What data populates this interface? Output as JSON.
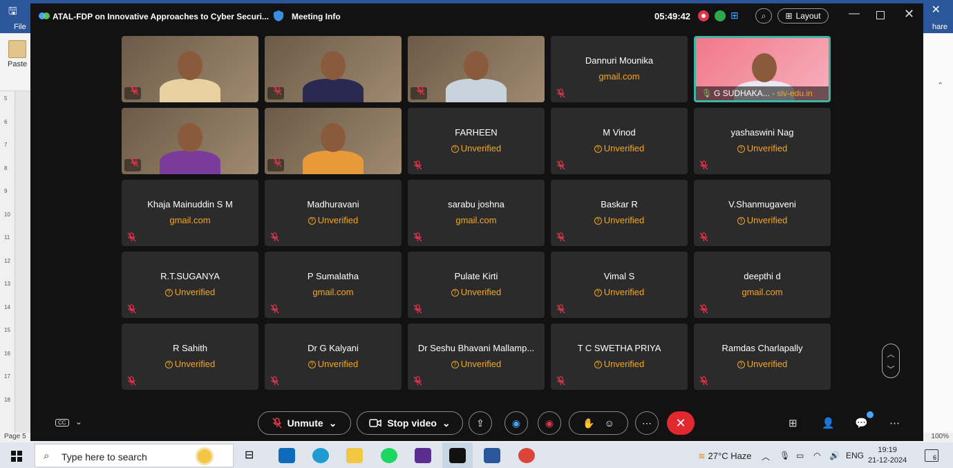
{
  "word": {
    "file_label": "File",
    "share_label": "hare",
    "paste_label": "Paste",
    "page_label": "Page 5",
    "zoom_label": "100%",
    "ruler_numbers": [
      "5",
      "6",
      "7",
      "8",
      "9",
      "10",
      "11",
      "12",
      "13",
      "14",
      "15",
      "16",
      "17",
      "18"
    ]
  },
  "meeting": {
    "title": "ATAL-FDP on Innovative Approaches to Cyber Securi...",
    "info_label": "Meeting Info",
    "timer": "05:49:42",
    "layout_label": "Layout"
  },
  "participants": [
    {
      "video": true,
      "name": "",
      "sub": "",
      "tone": "#caa47a",
      "shirt": "#e8d0a0"
    },
    {
      "video": true,
      "name": "",
      "sub": "",
      "tone": "#6b4a2e",
      "shirt": "#2a2a50"
    },
    {
      "video": true,
      "name": "",
      "sub": "",
      "tone": "#b69a86",
      "shirt": "#c8d4dc"
    },
    {
      "video": false,
      "name": "Dannuri  Mounika",
      "sub": "gmail.com",
      "unverified": false
    },
    {
      "video": true,
      "active": true,
      "name": "G SUDHAKA...",
      "domain": "slv-edu.in",
      "tone": "#f08a9a",
      "shirt": "#e8e8f0"
    },
    {
      "video": true,
      "name": "",
      "sub": "",
      "tone": "#bfbcb8",
      "shirt": "#7a3b9c"
    },
    {
      "video": true,
      "name": "",
      "sub": "",
      "tone": "#c9b6a6",
      "shirt": "#e89a3a"
    },
    {
      "video": false,
      "name": "FARHEEN",
      "sub": "Unverified",
      "unverified": true
    },
    {
      "video": false,
      "name": "M Vinod",
      "sub": "Unverified",
      "unverified": true
    },
    {
      "video": false,
      "name": "yashaswini Nag",
      "sub": "Unverified",
      "unverified": true
    },
    {
      "video": false,
      "name": "Khaja Mainuddin S M",
      "sub": "gmail.com",
      "unverified": false
    },
    {
      "video": false,
      "name": "Madhuravani",
      "sub": "Unverified",
      "unverified": true
    },
    {
      "video": false,
      "name": "sarabu joshna",
      "sub": "gmail.com",
      "unverified": false
    },
    {
      "video": false,
      "name": "Baskar R",
      "sub": "Unverified",
      "unverified": true
    },
    {
      "video": false,
      "name": "V.Shanmugaveni",
      "sub": "Unverified",
      "unverified": true
    },
    {
      "video": false,
      "name": "R.T.SUGANYA",
      "sub": "Unverified",
      "unverified": true
    },
    {
      "video": false,
      "name": "P Sumalatha",
      "sub": "gmail.com",
      "unverified": false
    },
    {
      "video": false,
      "name": "Pulate Kirti",
      "sub": "Unverified",
      "unverified": true
    },
    {
      "video": false,
      "name": "Vimal S",
      "sub": "Unverified",
      "unverified": true
    },
    {
      "video": false,
      "name": "deepthi d",
      "sub": "gmail.com",
      "unverified": false
    },
    {
      "video": false,
      "name": "R Sahith",
      "sub": "Unverified",
      "unverified": true
    },
    {
      "video": false,
      "name": "Dr G Kalyani",
      "sub": "Unverified",
      "unverified": true
    },
    {
      "video": false,
      "name": "Dr Seshu Bhavani Mallamp...",
      "sub": "Unverified",
      "unverified": true
    },
    {
      "video": false,
      "name": "T C SWETHA PRIYA",
      "sub": "Unverified",
      "unverified": true
    },
    {
      "video": false,
      "name": "Ramdas Charlapally",
      "sub": "Unverified",
      "unverified": true
    }
  ],
  "controls": {
    "unmute_label": "Unmute",
    "stop_video_label": "Stop video"
  },
  "taskbar": {
    "search_placeholder": "Type here to search",
    "weather": "27°C  Haze",
    "language": "ENG",
    "time": "19:19",
    "date": "21-12-2024",
    "notifications": "6"
  },
  "colors": {
    "accent_orange": "#f5a623",
    "active_border": "#3fb6a4",
    "end_call": "#e0282e",
    "word_blue": "#2b579a"
  }
}
